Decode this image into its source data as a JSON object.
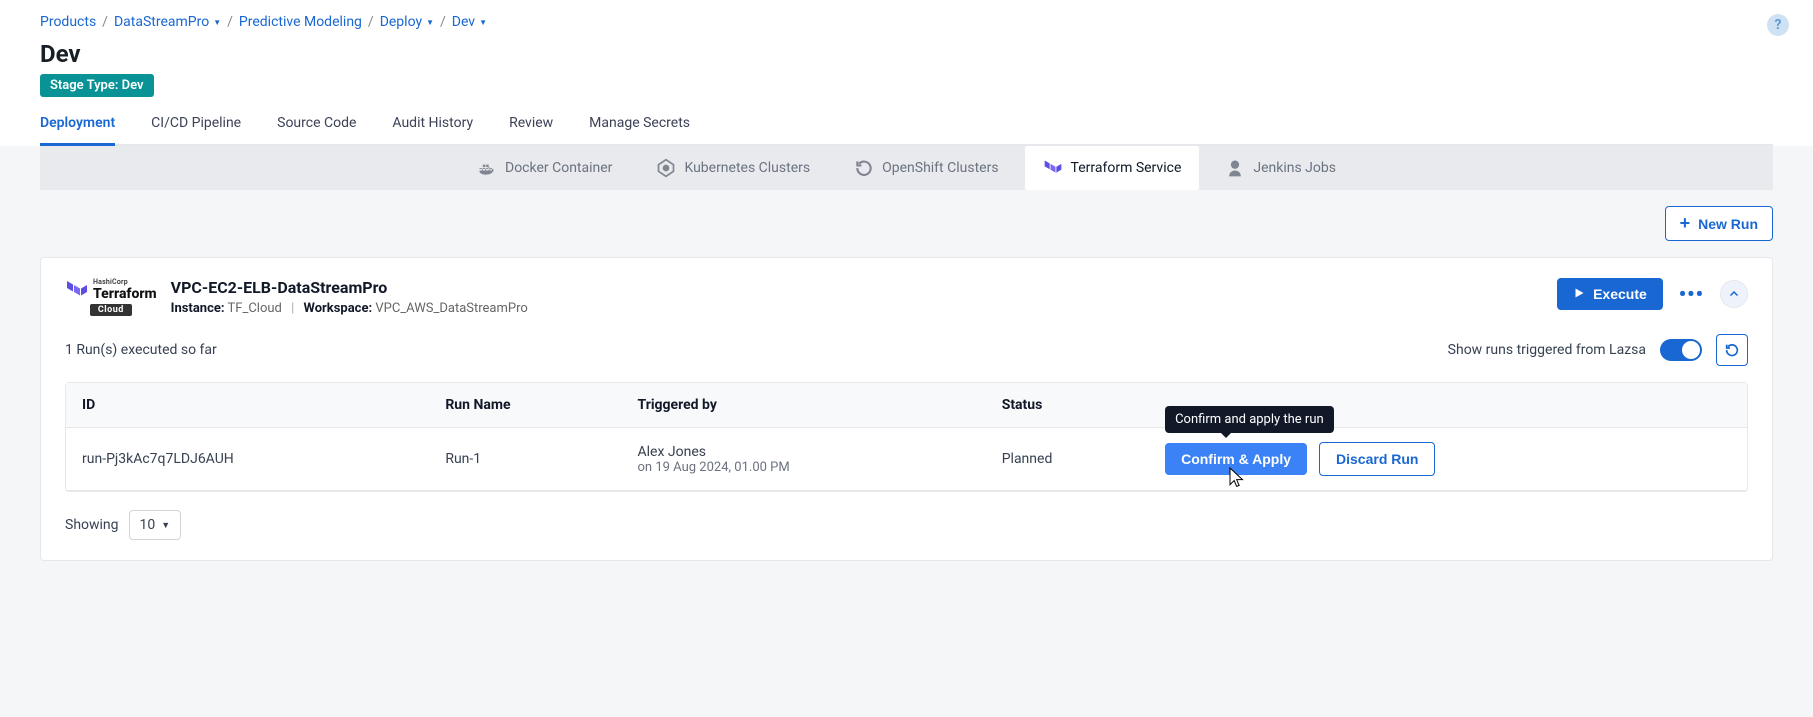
{
  "breadcrumb": {
    "products": "Products",
    "datastream": "DataStreamPro",
    "predictive": "Predictive Modeling",
    "deploy": "Deploy",
    "dev": "Dev"
  },
  "page": {
    "title": "Dev",
    "stage_badge": "Stage Type: Dev"
  },
  "tabs": {
    "deployment": "Deployment",
    "cicd": "CI/CD Pipeline",
    "source": "Source Code",
    "audit": "Audit History",
    "review": "Review",
    "secrets": "Manage Secrets"
  },
  "subtabs": {
    "docker": "Docker Container",
    "k8s": "Kubernetes Clusters",
    "openshift": "OpenShift Clusters",
    "terraform": "Terraform Service",
    "jenkins": "Jenkins Jobs"
  },
  "toolbar": {
    "new_run": "New Run"
  },
  "terraform": {
    "brand_hashicorp": "HashiCorp",
    "brand_name": "Terraform",
    "brand_cloud": "Cloud",
    "title": "VPC-EC2-ELB-DataStreamPro",
    "instance_label": "Instance:",
    "instance_value": "TF_Cloud",
    "workspace_label": "Workspace:",
    "workspace_value": "VPC_AWS_DataStreamPro",
    "execute": "Execute",
    "runs_executed": "1 Run(s) executed so far",
    "show_runs_label": "Show runs triggered from Lazsa"
  },
  "table": {
    "headers": {
      "id": "ID",
      "run_name": "Run Name",
      "triggered_by": "Triggered by",
      "status": "Status"
    },
    "rows": [
      {
        "id": "run-Pj3kAc7q7LDJ6AUH",
        "run_name": "Run-1",
        "triggered_by_name": "Alex Jones",
        "triggered_by_time": "on 19 Aug 2024, 01.00 PM",
        "status": "Planned",
        "confirm_label": "Confirm & Apply",
        "discard_label": "Discard Run",
        "tooltip": "Confirm and apply the run"
      }
    ]
  },
  "pager": {
    "showing": "Showing",
    "size": "10"
  }
}
